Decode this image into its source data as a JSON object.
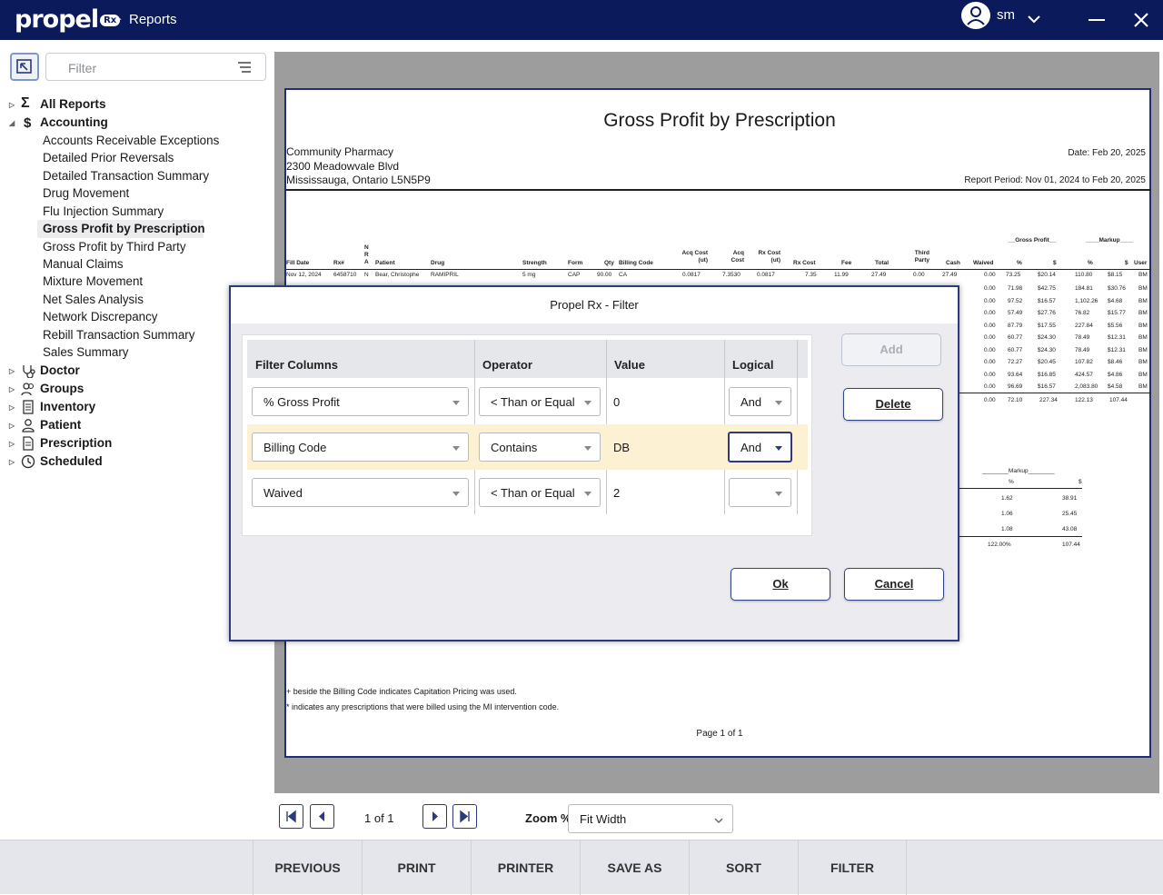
{
  "app": {
    "logo": "propel",
    "logo_badge": "Rx",
    "breadcrumb": "Reports",
    "user": "sm"
  },
  "sidebar": {
    "filter_placeholder": "Filter",
    "categories": [
      {
        "label": "All Reports",
        "icon": "sigma-icon"
      },
      {
        "label": "Accounting",
        "icon": "dollar-icon",
        "expanded": true
      },
      {
        "label": "Doctor",
        "icon": "stethoscope-icon"
      },
      {
        "label": "Groups",
        "icon": "people-icon"
      },
      {
        "label": "Inventory",
        "icon": "inventory-icon"
      },
      {
        "label": "Patient",
        "icon": "person-icon"
      },
      {
        "label": "Prescription",
        "icon": "prescription-icon"
      },
      {
        "label": "Scheduled",
        "icon": "clock-icon"
      }
    ],
    "accounting_items": [
      "Accounts Receivable Exceptions",
      "Detailed Prior Reversals",
      "Detailed Transaction Summary",
      "Drug Movement",
      "Flu Injection Summary",
      "Gross Profit by Prescription",
      "Gross Profit by Third Party",
      "Manual Claims",
      "Mixture Movement",
      "Net Sales Analysis",
      "Network Discrepancy",
      "Rebill Transaction Summary",
      "Sales Summary"
    ],
    "selected": "Gross Profit by Prescription"
  },
  "report": {
    "title": "Gross Profit by Prescription",
    "pharmacy_name": "Community Pharmacy",
    "address1": "2300 Meadowvale Blvd",
    "address2": "Mississauga, Ontario L5N5P9",
    "date": "Date: Feb 20, 2025",
    "period": "Report Period: Nov 01, 2024 to Feb 20, 2025",
    "group_gross_profit": "__Gross Profit__",
    "group_markup": "____Markup____",
    "columns": [
      "Fill Date",
      "Rx#",
      "N R A",
      "Patient",
      "Drug",
      "Strength",
      "Form",
      "Qty",
      "Billing Code",
      "Acq Cost (ut)",
      "Acq Cost",
      "Rx Cost (ut)",
      "Rx Cost",
      "Fee",
      "Total",
      "Third Party",
      "Cash",
      "Waived",
      "%",
      "$",
      "%",
      "$",
      "User"
    ],
    "first_row": [
      "Nov 12, 2024",
      "6458710",
      "N",
      "Bear, Christophe",
      "RAMIPRIL",
      "5 mg",
      "CAP",
      "90.00",
      "CA",
      "0.0817",
      "7.3530",
      "0.0817",
      "7.35",
      "11.99",
      "27.49",
      "0.00",
      "27.49",
      "0.00",
      "73.25",
      "$20.14",
      "110.80",
      "$8.15",
      "BM"
    ],
    "visible_rows": [
      [
        "0.00",
        "71.98",
        "$42.75",
        "184.81",
        "$30.76",
        "BM"
      ],
      [
        "0.00",
        "97.52",
        "$16.57",
        "1,102.26",
        "$4.68",
        "BM"
      ],
      [
        "0.00",
        "57.49",
        "$27.76",
        "76.82",
        "$15.77",
        "BM"
      ],
      [
        "0.00",
        "87.79",
        "$17.55",
        "227.84",
        "$5.56",
        "BM"
      ],
      [
        "0.00",
        "60.77",
        "$24.30",
        "78.49",
        "$12.31",
        "BM"
      ],
      [
        "0.00",
        "60.77",
        "$24.30",
        "78.49",
        "$12.31",
        "BM"
      ],
      [
        "0.00",
        "72.27",
        "$20.45",
        "107.82",
        "$8.46",
        "BM"
      ],
      [
        "0.00",
        "93.64",
        "$16.85",
        "424.57",
        "$4.86",
        "BM"
      ],
      [
        "0.00",
        "96.69",
        "$16.57",
        "2,083.80",
        "$4.58",
        "BM"
      ]
    ],
    "totals_row": [
      "0.00",
      "72.10",
      "227.34",
      "122.13",
      "107.44"
    ],
    "summary_markup_label": "________Markup________",
    "summary_cols": [
      "%",
      "$"
    ],
    "summary_rows": [
      [
        "1.62",
        "38.91"
      ],
      [
        "1.06",
        "25.45"
      ],
      [
        "1.08",
        "43.08"
      ]
    ],
    "summary_total": [
      "122.00%",
      "107.44"
    ],
    "footnote1": "+ beside the Billing Code indicates Capitation Pricing was used.",
    "footnote2": "* indicates any prescriptions that were billed using the MI intervention code.",
    "page_label": "Page 1 of 1"
  },
  "pager": {
    "page_text": "1 of 1",
    "zoom_label": "Zoom %",
    "zoom_value": "Fit Width"
  },
  "bottom_buttons": [
    "PREVIOUS",
    "PRINT",
    "PRINTER",
    "SAVE AS",
    "SORT",
    "FILTER"
  ],
  "dialog": {
    "title": "Propel Rx - Filter",
    "headers": [
      "Filter Columns",
      "Operator",
      "Value",
      "Logical"
    ],
    "rows": [
      {
        "column": "% Gross Profit",
        "operator": "< Than or Equal",
        "value": "0",
        "logical": "And"
      },
      {
        "column": "Billing Code",
        "operator": "Contains",
        "value": "DB",
        "logical": "And"
      },
      {
        "column": "Waived",
        "operator": "< Than or Equal",
        "value": "2",
        "logical": ""
      }
    ],
    "add_label": "Add",
    "delete_label": "Delete",
    "ok_label": "Ok",
    "cancel_label": "Cancel",
    "highlight_color": "#fdf1d4"
  }
}
